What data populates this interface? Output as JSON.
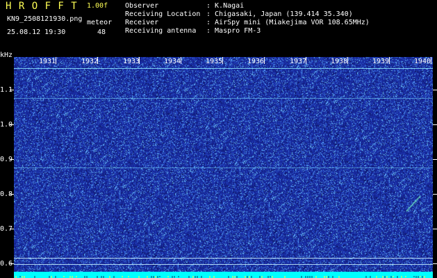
{
  "header": {
    "logo": "H R O F F T",
    "version": "1.00f",
    "filename": "KN9_2508121930.png",
    "meteor_label": "meteor",
    "datetime": "25.08.12 19:30",
    "count": "48",
    "info": [
      {
        "label": "Observer",
        "value": ": K.Nagai"
      },
      {
        "label": "Receiving Location",
        "value": ": Chigasaki, Japan (139.414 35.340)"
      },
      {
        "label": "Receiver",
        "value": ": AirSpy mini (Miakejima VOR 108.65MHz)"
      },
      {
        "label": "Receiving antenna",
        "value": ": Maspro FM-3"
      }
    ]
  },
  "spectrogram": {
    "y_unit": "kHz",
    "y_ticks": [
      "1.1",
      "1.0",
      "0.9",
      "0.8",
      "0.7",
      "0.6"
    ],
    "time_ticks": [
      "1931",
      "1932",
      "1933",
      "1934",
      "1935",
      "1936",
      "1937",
      "1938",
      "1939",
      "1940"
    ],
    "colors": {
      "background": "#1a2ba8",
      "noise": "#6fd0ff",
      "baseline": "#00ffff",
      "text_yellow": "#ffff55"
    }
  }
}
